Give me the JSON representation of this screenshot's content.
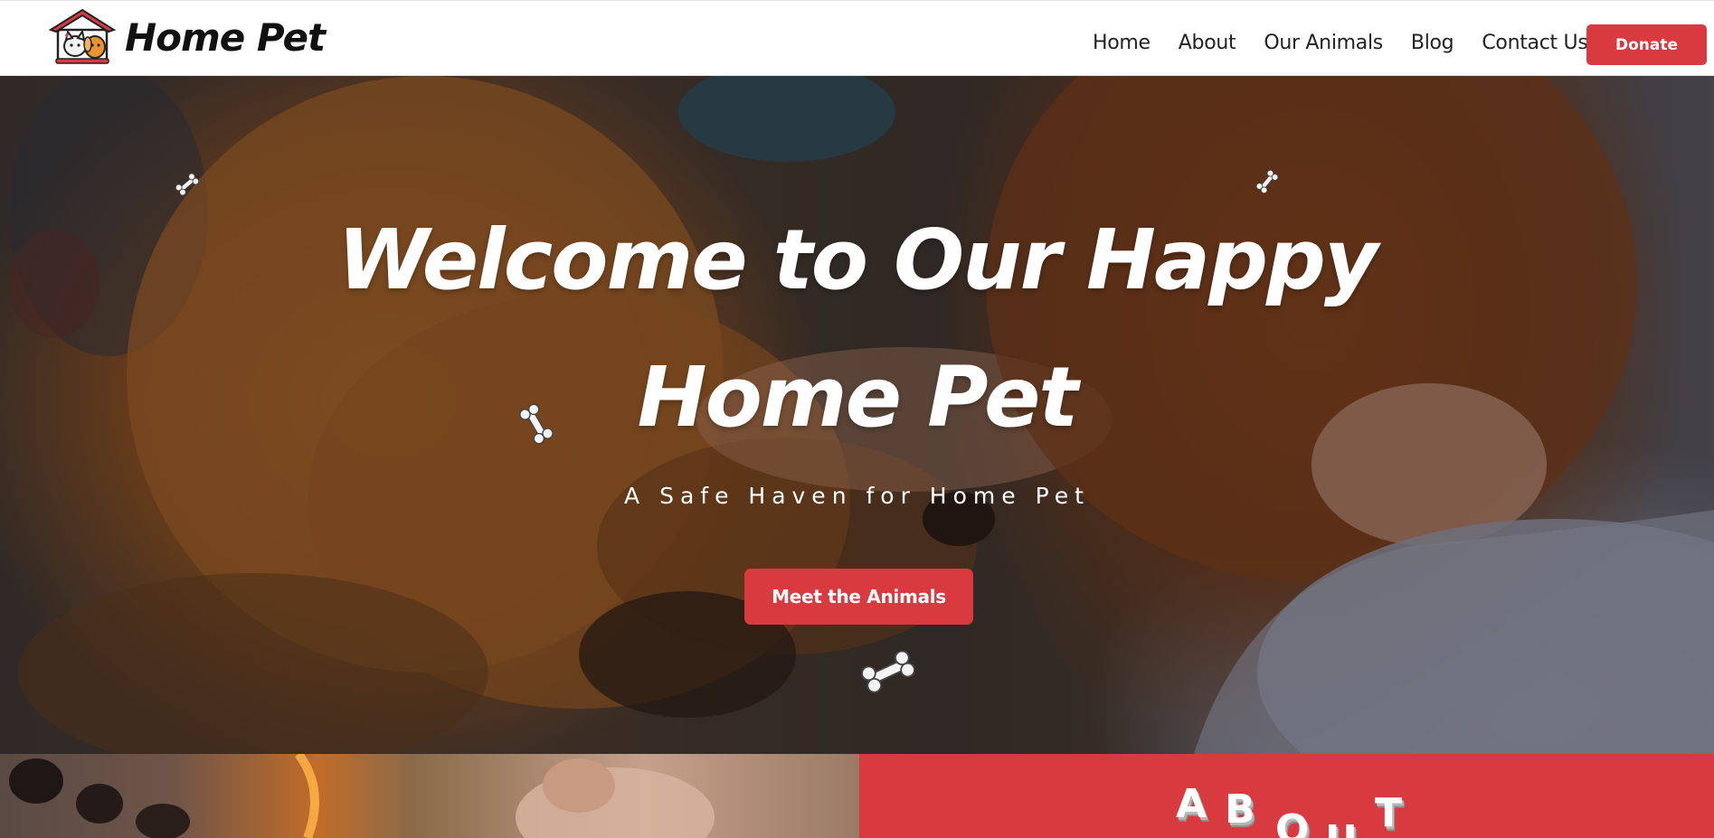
{
  "header": {
    "brand": "Home Pet",
    "nav": [
      {
        "label": "Home"
      },
      {
        "label": "About"
      },
      {
        "label": "Our Animals"
      },
      {
        "label": "Blog"
      },
      {
        "label": "Contact Us"
      }
    ],
    "donate_label": "Donate"
  },
  "hero": {
    "title_line1": "Welcome to Our Happy",
    "title_line2": "Home Pet",
    "subtitle": "A Safe Haven for Home Pet",
    "cta_label": "Meet the Animals"
  },
  "about": {
    "heading_letters": [
      "A",
      "B",
      "O",
      "U",
      "T"
    ]
  },
  "colors": {
    "accent": "#d93a3f",
    "text_dark": "#222222",
    "hero_text": "#ffffff"
  },
  "icons": [
    "home-pet-logo-icon",
    "dog-bone-icon"
  ]
}
